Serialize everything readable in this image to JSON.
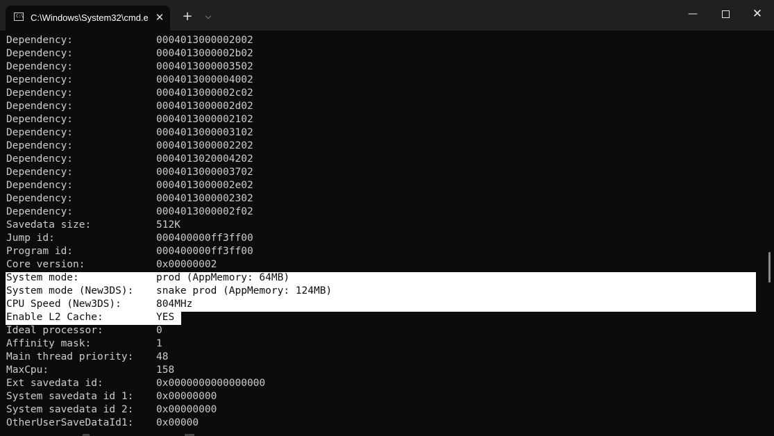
{
  "window": {
    "tab_title": "C:\\Windows\\System32\\cmd.e",
    "tab_icon": "cmd-prompt-icon",
    "tab_icon_text": "C:\\",
    "close_tab_glyph": "✕",
    "new_tab_glyph": "+",
    "dropdown_glyph": "⌵",
    "minimize_glyph": "—",
    "close_glyph": "✕"
  },
  "lines": [
    {
      "label": "Dependency:",
      "value": "0004013000002002"
    },
    {
      "label": "Dependency:",
      "value": "0004013000002b02"
    },
    {
      "label": "Dependency:",
      "value": "0004013000003502"
    },
    {
      "label": "Dependency:",
      "value": "0004013000004002"
    },
    {
      "label": "Dependency:",
      "value": "0004013000002c02"
    },
    {
      "label": "Dependency:",
      "value": "0004013000002d02"
    },
    {
      "label": "Dependency:",
      "value": "0004013000002102"
    },
    {
      "label": "Dependency:",
      "value": "0004013000003102"
    },
    {
      "label": "Dependency:",
      "value": "0004013000002202"
    },
    {
      "label": "Dependency:",
      "value": "0004013020004202"
    },
    {
      "label": "Dependency:",
      "value": "0004013000003702"
    },
    {
      "label": "Dependency:",
      "value": "0004013000002e02"
    },
    {
      "label": "Dependency:",
      "value": "0004013000002302"
    },
    {
      "label": "Dependency:",
      "value": "0004013000002f02"
    },
    {
      "label": "Savedata size:",
      "value": "512K"
    },
    {
      "label": "Jump id:",
      "value": "000400000ff3ff00"
    },
    {
      "label": "Program id:",
      "value": "000400000ff3ff00"
    },
    {
      "label": "Core version:",
      "value": "0x00000002"
    },
    {
      "label": "System mode:",
      "value": "prod (AppMemory: 64MB)"
    },
    {
      "label": "System mode (New3DS):",
      "value": "snake prod (AppMemory: 124MB)"
    },
    {
      "label": "CPU Speed (New3DS):",
      "value": "804MHz"
    },
    {
      "label": "Enable L2 Cache:",
      "value": "YES"
    },
    {
      "label": "Ideal processor:",
      "value": "0"
    },
    {
      "label": "Affinity mask:",
      "value": "1"
    },
    {
      "label": "Main thread priority:",
      "value": "48"
    },
    {
      "label": "MaxCpu:",
      "value": "158"
    },
    {
      "label": "Ext savedata id:",
      "value": "0x0000000000000000"
    },
    {
      "label": "System savedata id 1:",
      "value": "0x00000000"
    },
    {
      "label": "System savedata id 2:",
      "value": "0x00000000"
    },
    {
      "label": "OtherUserSaveDataId1:",
      "value": "0x00000"
    }
  ],
  "colors": {
    "background": "#0c0c0c",
    "text": "#cccccc",
    "selection_bg": "#ffffff",
    "selection_text": "#0c0c0c",
    "titlebar": "#202020"
  }
}
